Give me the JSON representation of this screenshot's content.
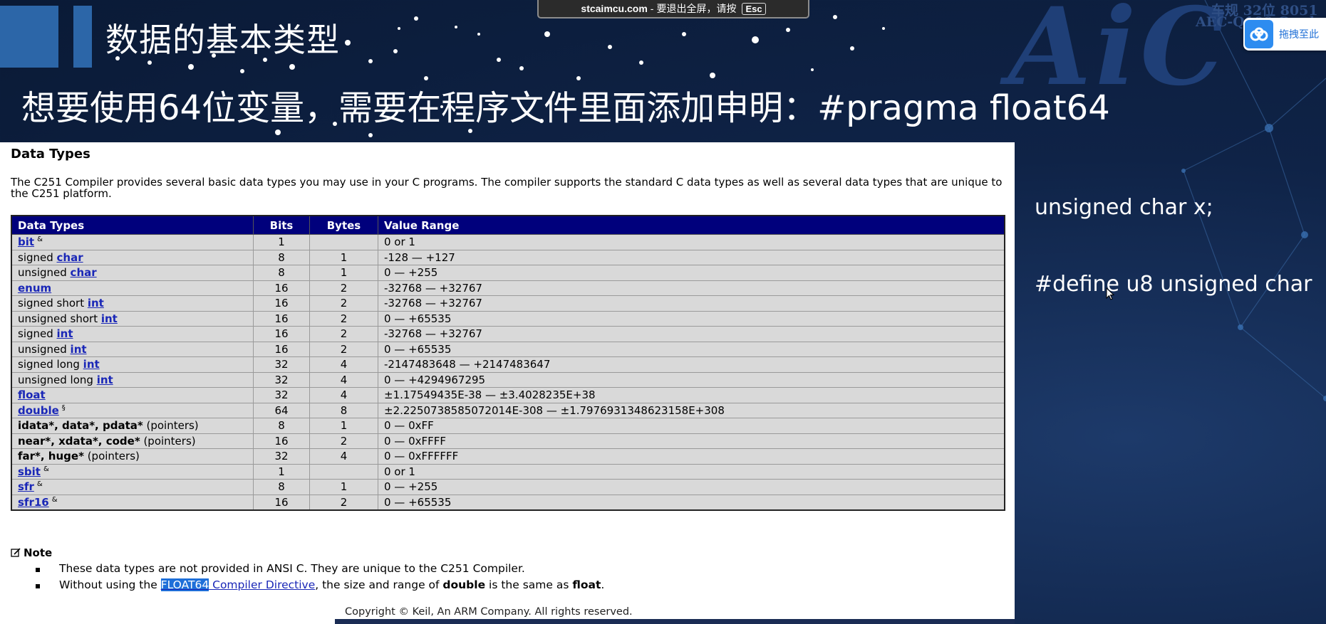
{
  "slide": {
    "title": "数据的基本类型",
    "subtitle": "想要使用64位变量，需要在程序文件里面添加申明：#pragma float64",
    "side_lines": [
      "unsigned char x;",
      "#define u8 unsigned char"
    ]
  },
  "logo": {
    "main": "AiC",
    "line1": "车规 32位 8051",
    "line2": "AEC-Q100 Grade"
  },
  "fullscreen_notice": {
    "site": "stcaimcu.com",
    "sep": "-",
    "text": "要退出全屏，请按",
    "key": "Esc"
  },
  "drag_widget": {
    "label": "拖拽至此"
  },
  "doc": {
    "heading": "Data Types",
    "intro": "The C251 Compiler provides several basic data types you may use in your C programs. The compiler supports the standard C data types as well as several data types that are unique to the C251 platform.",
    "columns": [
      "Data Types",
      "Bits",
      "Bytes",
      "Value Range"
    ],
    "rows": [
      {
        "prefix": "",
        "link": "bit",
        "suffix": "",
        "sup": "&",
        "bits": "1",
        "bytes": "",
        "range": "0 or 1"
      },
      {
        "prefix": "signed ",
        "link": "char",
        "suffix": "",
        "sup": "",
        "bits": "8",
        "bytes": "1",
        "range": "-128 — +127"
      },
      {
        "prefix": "unsigned ",
        "link": "char",
        "suffix": "",
        "sup": "",
        "bits": "8",
        "bytes": "1",
        "range": "0 — +255"
      },
      {
        "prefix": "",
        "link": "enum",
        "suffix": "",
        "sup": "",
        "bits": "16",
        "bytes": "2",
        "range": "-32768 — +32767"
      },
      {
        "prefix": "signed short ",
        "link": "int",
        "suffix": "",
        "sup": "",
        "bits": "16",
        "bytes": "2",
        "range": "-32768 — +32767"
      },
      {
        "prefix": "unsigned short ",
        "link": "int",
        "suffix": "",
        "sup": "",
        "bits": "16",
        "bytes": "2",
        "range": "0 — +65535"
      },
      {
        "prefix": "signed ",
        "link": "int",
        "suffix": "",
        "sup": "",
        "bits": "16",
        "bytes": "2",
        "range": "-32768 — +32767"
      },
      {
        "prefix": "unsigned ",
        "link": "int",
        "suffix": "",
        "sup": "",
        "bits": "16",
        "bytes": "2",
        "range": "0 — +65535"
      },
      {
        "prefix": "signed long ",
        "link": "int",
        "suffix": "",
        "sup": "",
        "bits": "32",
        "bytes": "4",
        "range": "-2147483648 — +2147483647"
      },
      {
        "prefix": "unsigned long ",
        "link": "int",
        "suffix": "",
        "sup": "",
        "bits": "32",
        "bytes": "4",
        "range": "0 — +4294967295"
      },
      {
        "prefix": "",
        "link": "float",
        "suffix": "",
        "sup": "",
        "bits": "32",
        "bytes": "4",
        "range": "±1.17549435E-38 — ±3.4028235E+38"
      },
      {
        "prefix": "",
        "link": "double",
        "suffix": "",
        "sup": "§",
        "bits": "64",
        "bytes": "8",
        "range": "±2.2250738585072014E-308 — ±1.7976931348623158E+308"
      },
      {
        "bold": "idata*, data*, pdata*",
        "suffix": " (pointers)",
        "bits": "8",
        "bytes": "1",
        "range": "0 — 0xFF"
      },
      {
        "bold": "near*, xdata*, code*",
        "suffix": " (pointers)",
        "bits": "16",
        "bytes": "2",
        "range": "0 — 0xFFFF"
      },
      {
        "bold": "far*, huge*",
        "suffix": " (pointers)",
        "bits": "32",
        "bytes": "4",
        "range": "0 — 0xFFFFFF"
      },
      {
        "prefix": "",
        "link": "sbit",
        "suffix": "",
        "sup": "&",
        "bits": "1",
        "bytes": "",
        "range": "0 or 1"
      },
      {
        "prefix": "",
        "link": "sfr",
        "suffix": "",
        "sup": "&",
        "bits": "8",
        "bytes": "1",
        "range": "0 — +255"
      },
      {
        "prefix": "",
        "link": "sfr16",
        "suffix": "",
        "sup": "&",
        "bits": "16",
        "bytes": "2",
        "range": "0 — +65535"
      }
    ],
    "note": {
      "heading": "Note",
      "line1": "These data types are not provided in ANSI C. They are unique to the C251 Compiler.",
      "line2": {
        "before": "Without using the ",
        "highlight": "FLOAT64",
        "link_rest": " Compiler Directive",
        "mid": ", the size and range of ",
        "b1": "double",
        "mid2": " is the same as ",
        "b2": "float",
        "end": "."
      }
    },
    "copyright": "Copyright © Keil, An ARM Company. All rights reserved."
  },
  "colors": {
    "header_bg": "#00007c",
    "cell_bg": "#d9d9d9",
    "link": "#1a27b7",
    "slide_bg": "#0f2347"
  }
}
